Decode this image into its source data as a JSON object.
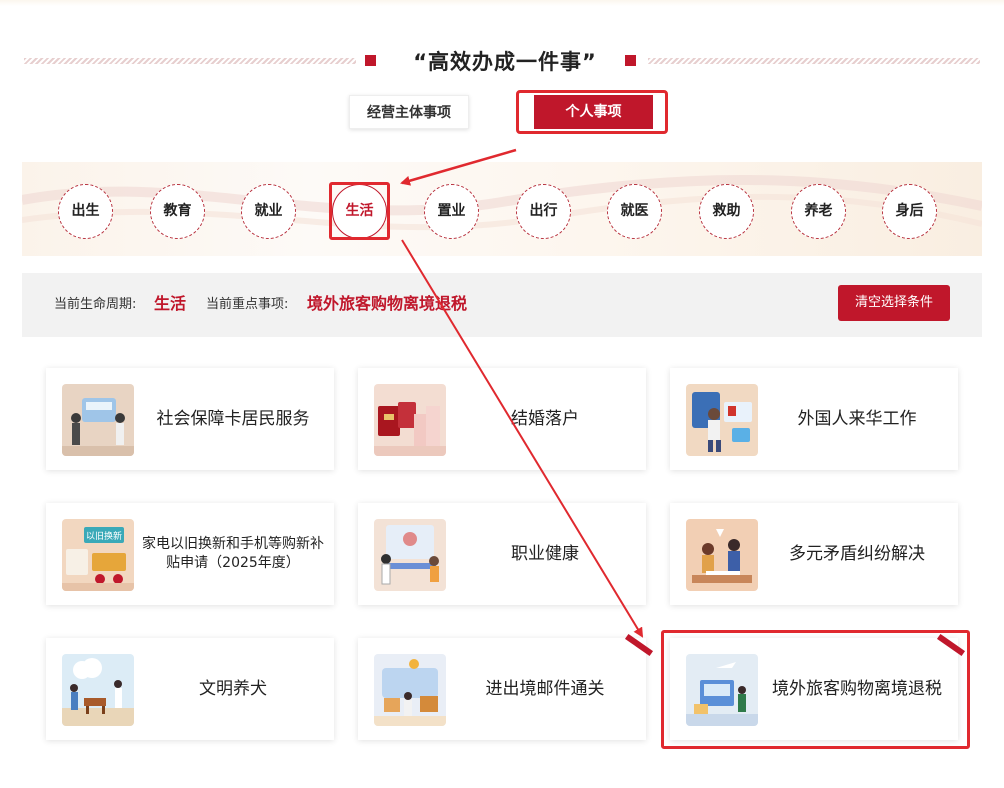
{
  "heading": {
    "title": "“高效办成一件事”"
  },
  "tabs": [
    {
      "label": "经营主体事项",
      "active": false
    },
    {
      "label": "个人事项",
      "active": true
    }
  ],
  "lifecycle": {
    "stages": [
      "出生",
      "教育",
      "就业",
      "生活",
      "置业",
      "出行",
      "就医",
      "救助",
      "养老",
      "身后"
    ],
    "active": "生活"
  },
  "filter": {
    "lifecycle_label": "当前生命周期:",
    "lifecycle_value": "生活",
    "focus_label": "当前重点事项:",
    "focus_value": "境外旅客购物离境退税",
    "clear_button": "清空选择条件"
  },
  "cards": [
    {
      "title": "社会保障卡居民服务",
      "icon": "social-security-card-illustration"
    },
    {
      "title": "结婚落户",
      "icon": "marriage-household-illustration"
    },
    {
      "title": "外国人来华工作",
      "icon": "foreigner-work-illustration"
    },
    {
      "title": "家电以旧换新和手机等购新补贴申请（2025年度）",
      "icon": "appliance-trade-in-illustration",
      "tag": "以旧换新"
    },
    {
      "title": "职业健康",
      "icon": "occupational-health-illustration"
    },
    {
      "title": "多元矛盾纠纷解决",
      "icon": "dispute-resolution-illustration"
    },
    {
      "title": "文明养犬",
      "icon": "dog-walking-illustration"
    },
    {
      "title": "进出境邮件通关",
      "icon": "postal-customs-illustration"
    },
    {
      "title": "境外旅客购物离境退税",
      "icon": "tax-refund-illustration",
      "highlighted": true
    }
  ],
  "colors": {
    "accent": "#c0172b",
    "annotation": "#e0292f",
    "band": "#fbf3ea"
  }
}
